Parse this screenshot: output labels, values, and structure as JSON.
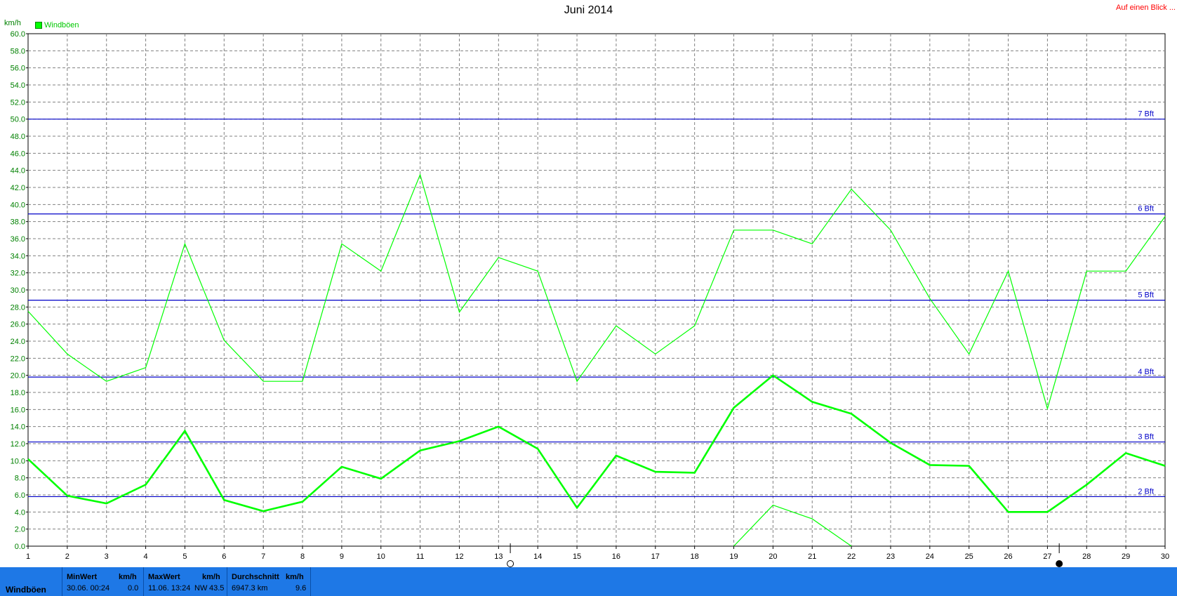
{
  "header": {
    "title": "Juni 2014",
    "top_link": "Auf einen Blick ...",
    "unit": "km/h",
    "legend": "Windböen"
  },
  "colors": {
    "series": "#00ff00",
    "bft_lines": "#0000c8",
    "grid": "#808080",
    "statusbar": "#1e78e6"
  },
  "chart_data": {
    "type": "line",
    "title": "Juni 2014",
    "ylabel": "km/h",
    "ylim": [
      0,
      60
    ],
    "xlim": [
      1,
      30
    ],
    "x_ticks": [
      "1",
      "2",
      "3",
      "4",
      "5",
      "6",
      "7",
      "8",
      "9",
      "10",
      "11",
      "12",
      "13",
      "14",
      "15",
      "16",
      "17",
      "18",
      "19",
      "20",
      "21",
      "22",
      "23",
      "24",
      "25",
      "26",
      "27",
      "28",
      "29",
      "30"
    ],
    "y_ticks": [
      "0.0",
      "2.0",
      "4.0",
      "6.0",
      "8.0",
      "10.0",
      "12.0",
      "14.0",
      "16.0",
      "18.0",
      "20.0",
      "22.0",
      "24.0",
      "26.0",
      "28.0",
      "30.0",
      "32.0",
      "34.0",
      "36.0",
      "38.0",
      "40.0",
      "42.0",
      "44.0",
      "46.0",
      "48.0",
      "50.0",
      "52.0",
      "54.0",
      "56.0",
      "58.0",
      "60.0"
    ],
    "grid": true,
    "legend_position": "top-left",
    "series": [
      {
        "name": "Windböen",
        "x": [
          1,
          2,
          3,
          4,
          5,
          6,
          7,
          8,
          9,
          10,
          11,
          12,
          13,
          14,
          15,
          16,
          17,
          18,
          19,
          20,
          21,
          22,
          23,
          24,
          25,
          26,
          27,
          28,
          29,
          30
        ],
        "values": [
          27.5,
          22.5,
          19.3,
          20.9,
          35.4,
          24.1,
          19.3,
          19.3,
          35.4,
          32.2,
          43.5,
          27.4,
          33.8,
          32.2,
          19.3,
          25.8,
          22.5,
          25.8,
          37.0,
          37.0,
          35.4,
          41.8,
          37.0,
          29.0,
          22.5,
          32.2,
          16.1,
          32.2,
          32.2,
          38.6
        ]
      },
      {
        "x": [
          1,
          2,
          3,
          4,
          5,
          6,
          7,
          8,
          9,
          10,
          11,
          12,
          13,
          14,
          15,
          16,
          17,
          18,
          19,
          20,
          21,
          22,
          23,
          24,
          25,
          26,
          27,
          28,
          29,
          30
        ],
        "values": [
          10.2,
          5.9,
          5.0,
          7.2,
          13.5,
          5.4,
          4.1,
          5.2,
          9.3,
          7.9,
          11.2,
          12.3,
          14.0,
          11.4,
          4.5,
          10.6,
          8.7,
          8.6,
          16.2,
          20.0,
          16.9,
          15.5,
          12.1,
          9.5,
          9.4,
          4.0,
          4.0,
          7.2,
          10.9,
          9.4
        ]
      },
      {
        "x": [
          19,
          20,
          21,
          22
        ],
        "values": [
          0.0,
          4.8,
          3.2,
          0.0
        ]
      }
    ],
    "reference_lines": [
      {
        "label": "2 Bft",
        "value": 5.8
      },
      {
        "label": "3 Bft",
        "value": 12.2
      },
      {
        "label": "4 Bft",
        "value": 19.8
      },
      {
        "label": "5 Bft",
        "value": 28.8
      },
      {
        "label": "6 Bft",
        "value": 38.9
      },
      {
        "label": "7 Bft",
        "value": 50.0
      }
    ],
    "moon_phase_markers": [
      {
        "x": 13.3,
        "phase": "full-moon"
      },
      {
        "x": 27.3,
        "phase": "new-moon"
      }
    ]
  },
  "statusbar": {
    "series_name": "Windböen",
    "min": {
      "header": "MinWert",
      "unit": "km/h",
      "time": "30.06.  00:24",
      "value": "0.0"
    },
    "max": {
      "header": "MaxWert",
      "unit": "km/h",
      "time": "11.06.  13:24",
      "dir": "NW",
      "value": "43.5"
    },
    "avg": {
      "header": "Durchschnitt",
      "unit": "km/h",
      "distance": "6947.3 km",
      "value": "9.6"
    }
  }
}
